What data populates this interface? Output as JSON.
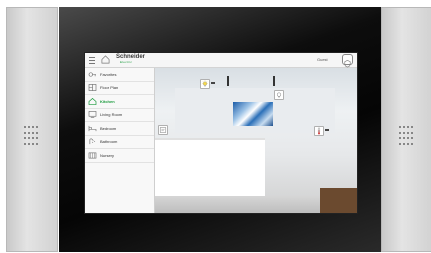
{
  "brand": {
    "name": "Schneider",
    "sub": "Electric"
  },
  "header": {
    "user": "Guest"
  },
  "sidebar": {
    "items": [
      {
        "label": "Favorites"
      },
      {
        "label": "Floor Plan"
      },
      {
        "label": "Kitchen",
        "active": true
      },
      {
        "label": "Living Room"
      },
      {
        "label": "Bedroom"
      },
      {
        "label": "Bathroom"
      },
      {
        "label": "Nursery"
      }
    ]
  },
  "room": {
    "name": "Kitchen",
    "controls": [
      {
        "icon": "lightbulb-on-icon"
      },
      {
        "icon": "lightbulb-icon"
      },
      {
        "icon": "thermostat-icon"
      },
      {
        "icon": "wall-panel-icon"
      }
    ]
  },
  "colors": {
    "accent": "#1a9a3c",
    "bezel": "#050505",
    "frame": "#d2d2d2"
  }
}
